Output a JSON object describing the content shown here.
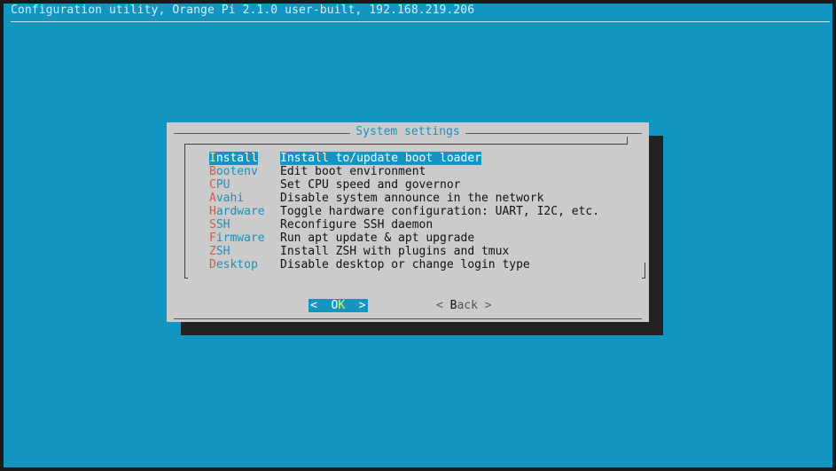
{
  "backtitle": "Configuration utility, Orange Pi 2.1.0 user-built, 192.168.219.206",
  "dialog": {
    "title": "System settings",
    "menu": [
      {
        "tag": "Install",
        "hot": "I",
        "rest": "nstall",
        "desc": "Install to/update boot loader",
        "selected": true
      },
      {
        "tag": "Bootenv",
        "hot": "B",
        "rest": "ootenv",
        "desc": "Edit boot environment",
        "selected": false
      },
      {
        "tag": "CPU",
        "hot": "C",
        "rest": "PU",
        "desc": "Set CPU speed and governor",
        "selected": false
      },
      {
        "tag": "Avahi",
        "hot": "A",
        "rest": "vahi",
        "desc": "Disable system announce in the network",
        "selected": false
      },
      {
        "tag": "Hardware",
        "hot": "H",
        "rest": "ardware",
        "desc": "Toggle hardware configuration: UART, I2C, etc.",
        "selected": false
      },
      {
        "tag": "SSH",
        "hot": "S",
        "rest": "SH",
        "desc": "Reconfigure SSH daemon",
        "selected": false
      },
      {
        "tag": "Firmware",
        "hot": "F",
        "rest": "irmware",
        "desc": "Run apt update & apt upgrade",
        "selected": false
      },
      {
        "tag": "ZSH",
        "hot": "Z",
        "rest": "SH",
        "desc": "Install ZSH with plugins and tmux",
        "selected": false
      },
      {
        "tag": "Desktop",
        "hot": "D",
        "rest": "esktop",
        "desc": "Disable desktop or change login type",
        "selected": false
      }
    ],
    "buttons": {
      "ok": {
        "left": "<  ",
        "pre": "O",
        "hot": "K",
        "right": "  >"
      },
      "back": {
        "left": "< ",
        "hot": "B",
        "rest": "ack",
        "right": " >"
      }
    }
  },
  "colors": {
    "background": "#1296c0",
    "dialog_bg": "#cbcbcb",
    "hotkey": "#d25a4a",
    "highlight_hotkey": "#f0f050"
  }
}
